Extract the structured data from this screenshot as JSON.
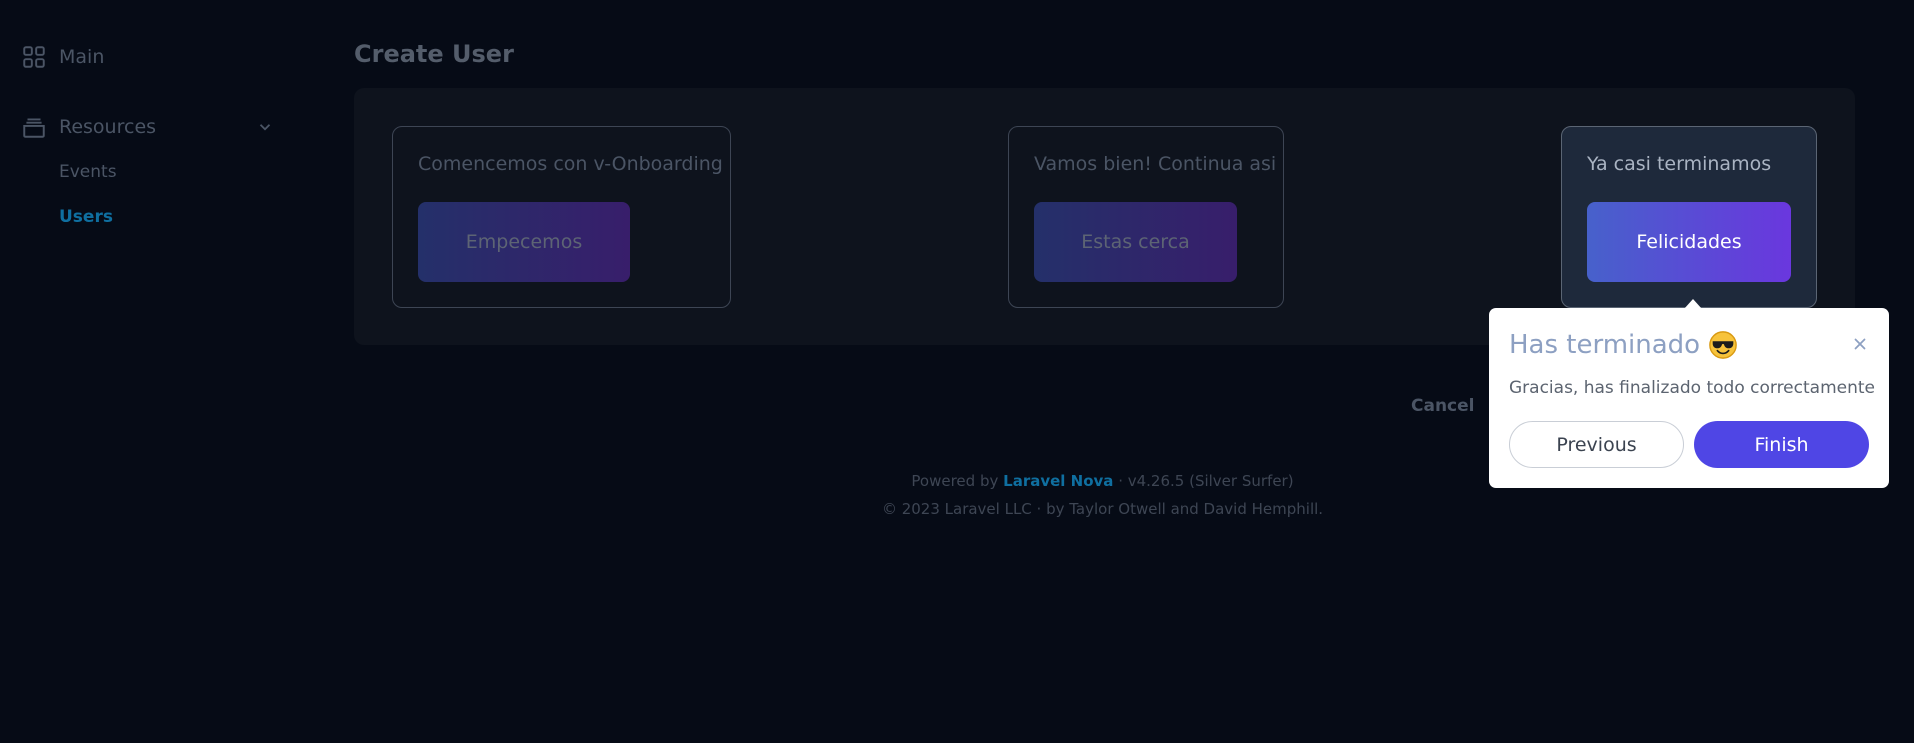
{
  "sidebar": {
    "main_label": "Main",
    "resources_label": "Resources",
    "items": [
      {
        "label": "Events"
      },
      {
        "label": "Users"
      }
    ]
  },
  "page": {
    "title": "Create User",
    "cancel_label": "Cancel"
  },
  "steps": [
    {
      "text": "Comencemos con v-Onboarding",
      "button": "Empecemos"
    },
    {
      "text": "Vamos bien! Continua asi",
      "button": "Estas cerca"
    },
    {
      "text": "Ya casi terminamos",
      "button": "Felicidades"
    }
  ],
  "popover": {
    "title": "Has terminado",
    "emoji_icon": "sunglasses-emoji-icon",
    "body": "Gracias, has finalizado todo correctamente",
    "previous_label": "Previous",
    "finish_label": "Finish"
  },
  "footer": {
    "powered_prefix": "Powered by",
    "brand": "Laravel Nova",
    "version": "· v4.26.5 (Silver Surfer)",
    "copyright": "© 2023 Laravel LLC · by Taylor Otwell and David Hemphill."
  },
  "colors": {
    "background": "#060b16",
    "accent": "#4f46e5",
    "link": "#0f6fa0"
  }
}
